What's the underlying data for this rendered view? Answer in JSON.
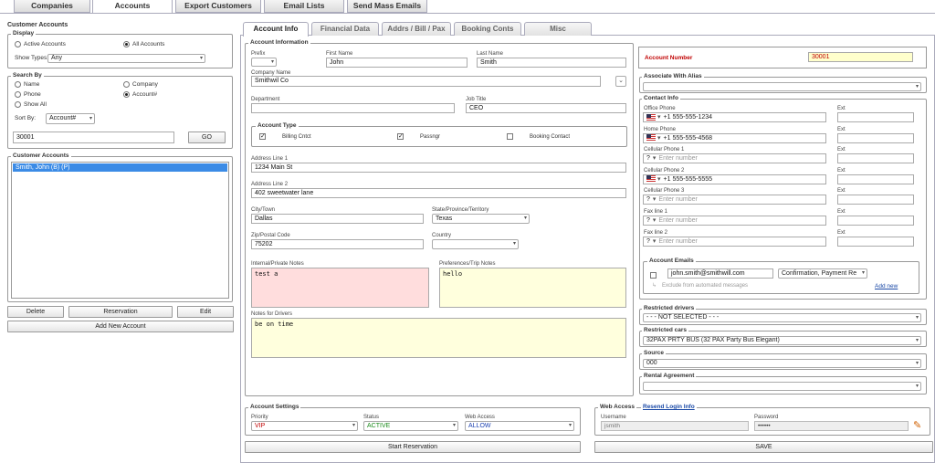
{
  "top_tabs": [
    "Companies",
    "Accounts",
    "Export Customers",
    "Email Lists",
    "Send Mass Emails"
  ],
  "left": {
    "title": "Customer Accounts",
    "display": {
      "legend": "Display",
      "active": "Active Accounts",
      "all": "All Accounts",
      "show_types_label": "Show Types:",
      "show_types_value": "Any"
    },
    "search": {
      "legend": "Search By",
      "name": "Name",
      "company": "Company",
      "phone": "Phone",
      "account": "Account#",
      "show_all": "Show All",
      "sort_label": "Sort By:",
      "sort_value": "Account#",
      "query": "30001",
      "go": "GO"
    },
    "list": {
      "legend": "Customer Accounts",
      "items": [
        "Smith, John (B) (P)"
      ]
    },
    "buttons": {
      "delete": "Delete",
      "reservation": "Reservation",
      "edit": "Edit",
      "add": "Add New Account"
    }
  },
  "inner_tabs": [
    "Account Info",
    "Financial Data",
    "Addrs / Bill / Pax",
    "Booking Conts",
    "Misc"
  ],
  "info": {
    "legend": "Account Information",
    "prefix_label": "Prefix",
    "first_label": "First Name",
    "first": "John",
    "last_label": "Last Name",
    "last": "Smith",
    "company_label": "Company Name",
    "company": "Smithwil Co",
    "dept_label": "Department",
    "dept": "",
    "job_label": "Job Title",
    "job": "CEO",
    "acct_type": {
      "legend": "Account Type",
      "billing": "Billing Cntct",
      "passngr": "Passngr",
      "booking": "Booking Contact"
    },
    "addr1_label": "Address Line 1",
    "addr1": "1234 Main St",
    "addr2_label": "Address Line 2",
    "addr2": "402 sweetwater lane",
    "city_label": "City/Town",
    "city": "Dallas",
    "state_label": "State/Province/Territory",
    "state": "Texas",
    "zip_label": "Zip/Postal Code",
    "zip": "75202",
    "country_label": "Country",
    "country": "",
    "internal_label": "Internal/Private Notes",
    "internal": "test a",
    "prefs_label": "Preferences/Trip Notes",
    "prefs": "hello",
    "drivers_notes_label": "Notes for Drivers",
    "drivers_notes": "be on time"
  },
  "account_number": {
    "label": "Account Number",
    "value": "30001"
  },
  "alias": {
    "legend": "Associate With Alias",
    "value": ""
  },
  "contact": {
    "legend": "Contact Info",
    "ext_label": "Ext",
    "placeholder": "Enter number",
    "phones": [
      {
        "label": "Office Phone",
        "value": "+1 555-555-1234",
        "flag": true
      },
      {
        "label": "Home Phone",
        "value": "+1 555-555-4568",
        "flag": true
      },
      {
        "label": "Cellular Phone 1",
        "value": "",
        "flag": false
      },
      {
        "label": "Cellular Phone 2",
        "value": "+1 555-555-5555",
        "flag": true
      },
      {
        "label": "Cellular Phone 3",
        "value": "",
        "flag": false
      },
      {
        "label": "Fax line 1",
        "value": "",
        "flag": false
      },
      {
        "label": "Fax line 2",
        "value": "",
        "flag": false
      }
    ],
    "emails": {
      "legend": "Account Emails",
      "email": "john.smith@smithwill.com",
      "type": "Confirmation, Payment Re",
      "exclude": "Exclude from automated messages",
      "add": "Add new"
    }
  },
  "restricted_drivers": {
    "legend": "Restricted drivers",
    "value": "- - - NOT SELECTED - - -"
  },
  "restricted_cars": {
    "legend": "Restricted cars",
    "value": "32PAX PRTY BUS (32 PAX Party Bus Elegant)"
  },
  "source": {
    "legend": "Source",
    "value": "000"
  },
  "rental": {
    "legend": "Rental Agreement",
    "value": ""
  },
  "settings": {
    "legend": "Account Settings",
    "priority_label": "Priority",
    "priority": "VIP",
    "status_label": "Status",
    "status": "ACTIVE",
    "web_label": "Web Access",
    "web": "ALLOW",
    "priority_color": "#c00000",
    "status_color": "#1a8a1a",
    "web_color": "#1a3fb0"
  },
  "web": {
    "legend": "Web Access",
    "resend": "Resend Login Info",
    "user_label": "Username",
    "user": "jsmith",
    "pass_label": "Password",
    "pass": "••••••"
  },
  "actions": {
    "start": "Start Reservation",
    "save": "SAVE"
  }
}
